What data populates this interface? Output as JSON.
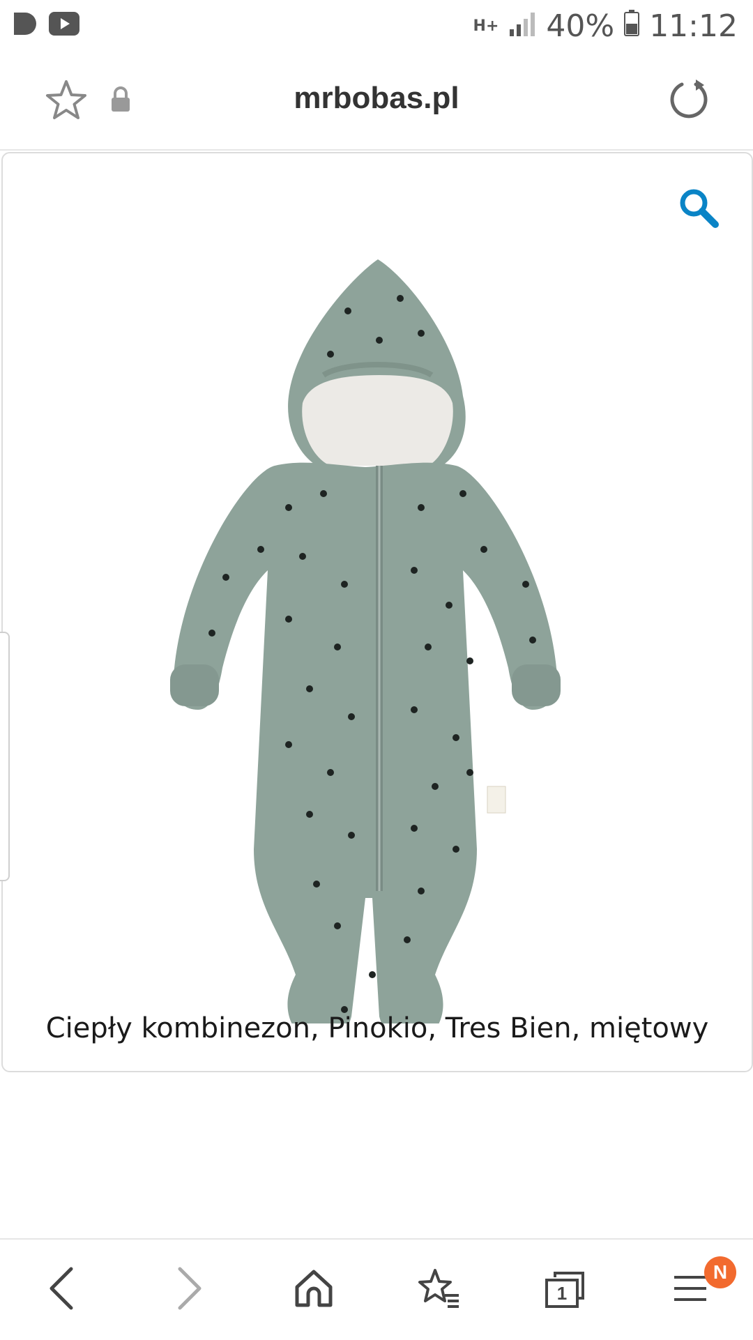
{
  "status_bar": {
    "left_icons": [
      "app-icon",
      "youtube-icon"
    ],
    "network": "H+",
    "battery": "40%",
    "time": "11:12"
  },
  "address_bar": {
    "url": "mrbobas.pl",
    "icons": [
      "star-icon",
      "lock-icon",
      "reload-icon"
    ]
  },
  "content": {
    "product_title": "Ciepły kombinezon, Pinokio, Tres Bien, miętowy",
    "accent_color": "#0a84c6",
    "product_color": "#8ea39a"
  },
  "bottom_nav": {
    "items": [
      "back-icon",
      "forward-icon",
      "home-icon",
      "bookmarks-icon",
      "tabs-icon",
      "menu-icon"
    ],
    "tabs_count": "1",
    "menu_badge": "N",
    "badge_color": "#f26a2e"
  }
}
